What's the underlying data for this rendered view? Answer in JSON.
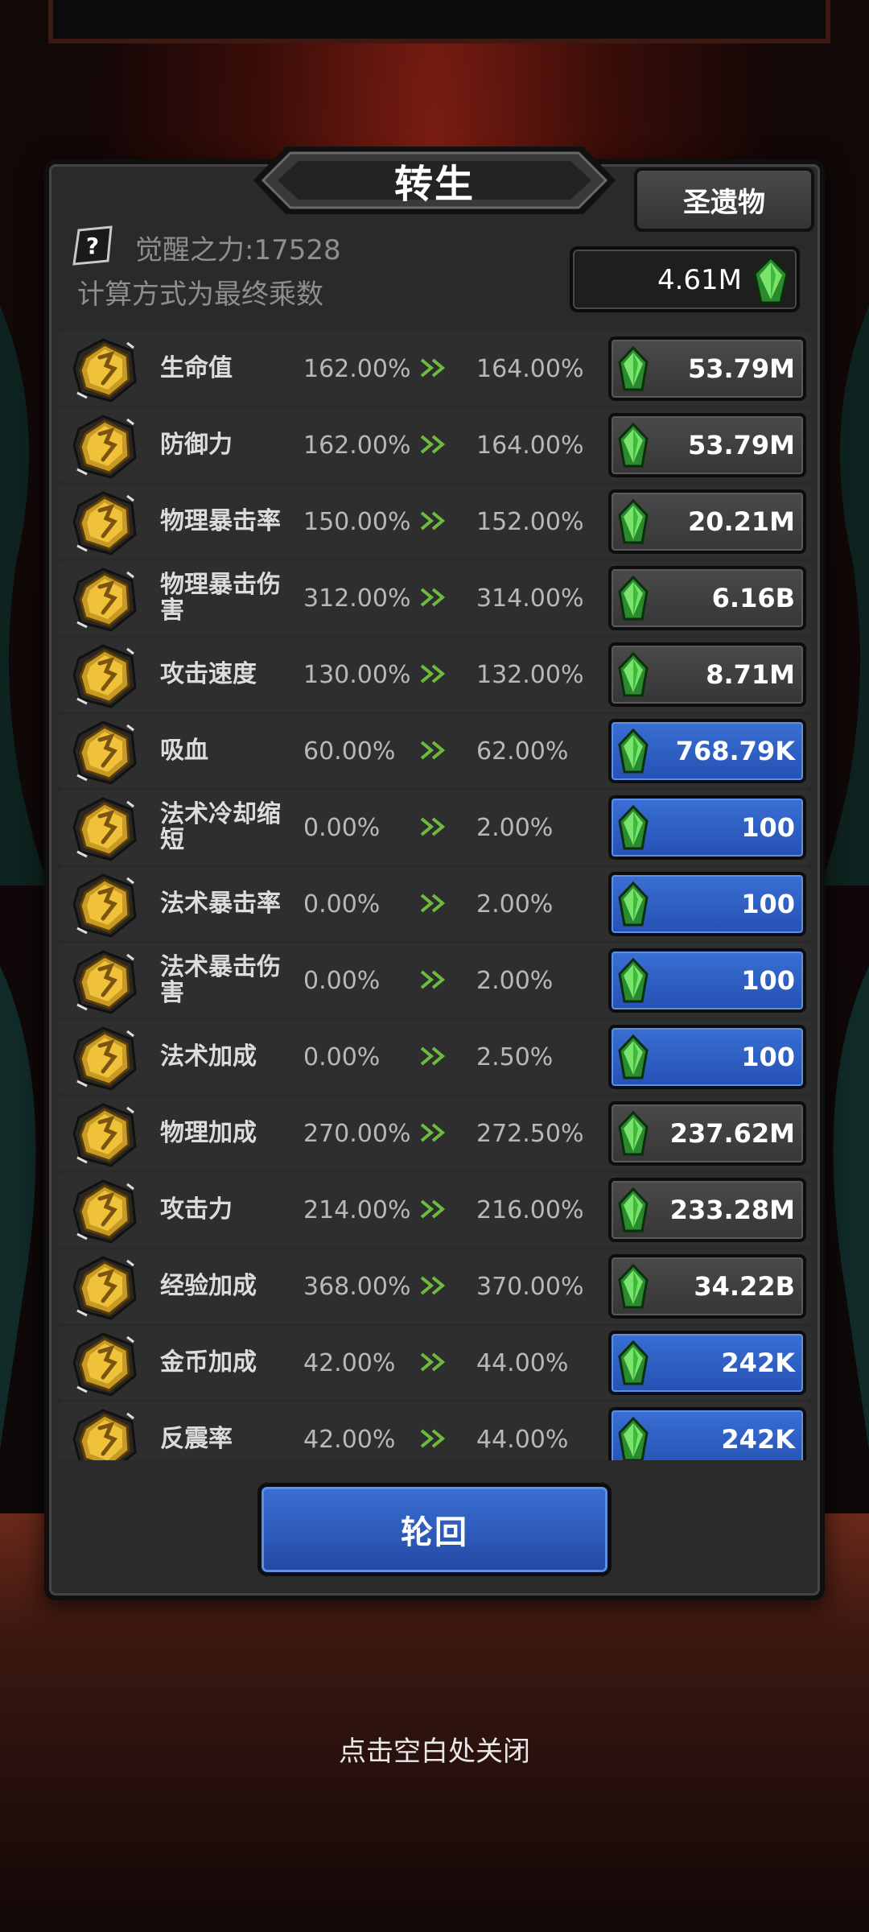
{
  "title": "转生",
  "relic_button": "圣遗物",
  "awaken_power": "觉醒之力:17528",
  "calc_note": "计算方式为最终乘数",
  "currency": {
    "value": "4.61M",
    "icon": "green-gem-icon"
  },
  "stats": [
    {
      "name": "生命值",
      "current": "162.00%",
      "next": "164.00%",
      "cost": "53.79M",
      "style": "dark"
    },
    {
      "name": "防御力",
      "current": "162.00%",
      "next": "164.00%",
      "cost": "53.79M",
      "style": "dark"
    },
    {
      "name": "物理暴击率",
      "current": "150.00%",
      "next": "152.00%",
      "cost": "20.21M",
      "style": "dark"
    },
    {
      "name": "物理暴击伤害",
      "current": "312.00%",
      "next": "314.00%",
      "cost": "6.16B",
      "style": "dark"
    },
    {
      "name": "攻击速度",
      "current": "130.00%",
      "next": "132.00%",
      "cost": "8.71M",
      "style": "dark"
    },
    {
      "name": "吸血",
      "current": "60.00%",
      "next": "62.00%",
      "cost": "768.79K",
      "style": "blue"
    },
    {
      "name": "法术冷却缩短",
      "current": "0.00%",
      "next": "2.00%",
      "cost": "100",
      "style": "blue"
    },
    {
      "name": "法术暴击率",
      "current": "0.00%",
      "next": "2.00%",
      "cost": "100",
      "style": "blue"
    },
    {
      "name": "法术暴击伤害",
      "current": "0.00%",
      "next": "2.00%",
      "cost": "100",
      "style": "blue"
    },
    {
      "name": "法术加成",
      "current": "0.00%",
      "next": "2.50%",
      "cost": "100",
      "style": "blue"
    },
    {
      "name": "物理加成",
      "current": "270.00%",
      "next": "272.50%",
      "cost": "237.62M",
      "style": "dark"
    },
    {
      "name": "攻击力",
      "current": "214.00%",
      "next": "216.00%",
      "cost": "233.28M",
      "style": "dark"
    },
    {
      "name": "经验加成",
      "current": "368.00%",
      "next": "370.00%",
      "cost": "34.22B",
      "style": "dark"
    },
    {
      "name": "金币加成",
      "current": "42.00%",
      "next": "44.00%",
      "cost": "242K",
      "style": "blue"
    },
    {
      "name": "反震率",
      "current": "42.00%",
      "next": "44.00%",
      "cost": "242K",
      "style": "blue"
    }
  ],
  "rebirth_button": "轮回",
  "close_hint": "点击空白处关闭",
  "colors": {
    "blue_button": "#2f5fc4",
    "dark_button": "#3f3e3e",
    "panel": "#2b2a2a",
    "gem": "#5fd05a"
  }
}
